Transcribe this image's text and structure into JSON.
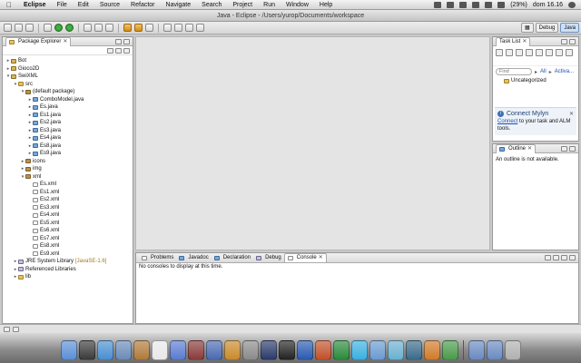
{
  "menubar": {
    "app_name": "Eclipse",
    "menus": [
      "File",
      "Edit",
      "Source",
      "Refactor",
      "Navigate",
      "Search",
      "Project",
      "Run",
      "Window",
      "Help"
    ],
    "battery": "(29%)",
    "clock": "dom 16.16"
  },
  "window": {
    "title": "Java - Eclipse - /Users/yurop/Documents/workspace"
  },
  "toolbar": {
    "perspectives": [
      "Debug",
      "Java"
    ]
  },
  "package_explorer": {
    "title": "Package Explorer",
    "items": [
      {
        "label": "Bot",
        "kind": "project",
        "depth": 0,
        "expand": "closed"
      },
      {
        "label": "Gioco2D",
        "kind": "project",
        "depth": 0,
        "expand": "closed"
      },
      {
        "label": "SwiXML",
        "kind": "project",
        "depth": 0,
        "expand": "open"
      },
      {
        "label": "src",
        "kind": "folder",
        "depth": 1,
        "expand": "open"
      },
      {
        "label": "(default package)",
        "kind": "pkg",
        "depth": 2,
        "expand": "open"
      },
      {
        "label": "ComboModel.java",
        "kind": "java",
        "depth": 3,
        "expand": "closed"
      },
      {
        "label": "Es.java",
        "kind": "java",
        "depth": 3,
        "expand": "closed"
      },
      {
        "label": "Es1.java",
        "kind": "java",
        "depth": 3,
        "expand": "closed"
      },
      {
        "label": "Es2.java",
        "kind": "java",
        "depth": 3,
        "expand": "closed"
      },
      {
        "label": "Es3.java",
        "kind": "java",
        "depth": 3,
        "expand": "closed"
      },
      {
        "label": "Es4.java",
        "kind": "java",
        "depth": 3,
        "expand": "closed"
      },
      {
        "label": "Es8.java",
        "kind": "java",
        "depth": 3,
        "expand": "closed"
      },
      {
        "label": "Es9.java",
        "kind": "java",
        "depth": 3,
        "expand": "closed"
      },
      {
        "label": "icons",
        "kind": "pkg",
        "depth": 2,
        "expand": "closed"
      },
      {
        "label": "img",
        "kind": "pkg",
        "depth": 2,
        "expand": "closed"
      },
      {
        "label": "xml",
        "kind": "pkg",
        "depth": 2,
        "expand": "open"
      },
      {
        "label": "Es.xml",
        "kind": "xml",
        "depth": 3,
        "expand": "none"
      },
      {
        "label": "Es1.xml",
        "kind": "xml",
        "depth": 3,
        "expand": "none"
      },
      {
        "label": "Es2.xml",
        "kind": "xml",
        "depth": 3,
        "expand": "none"
      },
      {
        "label": "Es3.xml",
        "kind": "xml",
        "depth": 3,
        "expand": "none"
      },
      {
        "label": "Es4.xml",
        "kind": "xml",
        "depth": 3,
        "expand": "none"
      },
      {
        "label": "Es5.xml",
        "kind": "xml",
        "depth": 3,
        "expand": "none"
      },
      {
        "label": "Es6.xml",
        "kind": "xml",
        "depth": 3,
        "expand": "none"
      },
      {
        "label": "Es7.xml",
        "kind": "xml",
        "depth": 3,
        "expand": "none"
      },
      {
        "label": "Es8.xml",
        "kind": "xml",
        "depth": 3,
        "expand": "none"
      },
      {
        "label": "Es9.xml",
        "kind": "xml",
        "depth": 3,
        "expand": "none"
      },
      {
        "label": "JRE System Library",
        "suffix": "[JavaSE-1.6]",
        "kind": "lib",
        "depth": 1,
        "expand": "closed"
      },
      {
        "label": "Referenced Libraries",
        "kind": "lib",
        "depth": 1,
        "expand": "closed"
      },
      {
        "label": "lib",
        "kind": "folder",
        "depth": 1,
        "expand": "closed"
      }
    ]
  },
  "task_list": {
    "title": "Task List",
    "find_placeholder": "Find",
    "all_label": "All",
    "activate_label": "Activa...",
    "category": "Uncategorized"
  },
  "mylyn": {
    "title": "Connect Mylyn",
    "link": "Connect",
    "text": " to your task and ALM tools."
  },
  "outline": {
    "title": "Outline",
    "message": "An outline is not available."
  },
  "console": {
    "tabs": [
      "Problems",
      "Javadoc",
      "Declaration",
      "Debug",
      "Console"
    ],
    "active_tab": "Console",
    "message": "No consoles to display at this time."
  },
  "dock": {
    "icons": [
      "finder-icon",
      "dashboard-icon",
      "safari-icon",
      "mail-icon",
      "address-book-icon",
      "ical-icon",
      "itunes-icon",
      "photo-booth-icon",
      "iphoto-icon",
      "garageband-icon",
      "system-preferences-icon",
      "eclipse-icon",
      "terminal-icon",
      "word-icon",
      "powerpoint-icon",
      "excel-icon",
      "messenger-icon",
      "preview-icon",
      "colorsync-icon",
      "time-machine-icon",
      "firefox-icon",
      "chrome-icon",
      "applications-folder-icon",
      "documents-folder-icon",
      "trash-icon"
    ],
    "colors": [
      "#5b8fd6",
      "#3a3a3a",
      "#4a8fd0",
      "#6a8bb8",
      "#b07a3a",
      "#e8e8e8",
      "#5a7bd0",
      "#8a3a3a",
      "#4a6ab0",
      "#c88a2a",
      "#8a8a8a",
      "#2a3a6a",
      "#222222",
      "#2a5ab0",
      "#c0502a",
      "#2a8a3a",
      "#3ab0e0",
      "#6a9ad0",
      "#6ab0d0",
      "#3a6a8a",
      "#d07a2a",
      "#4a9a4a",
      "#6a8ac0",
      "#6a8ac0",
      "#b0b0b0"
    ]
  }
}
